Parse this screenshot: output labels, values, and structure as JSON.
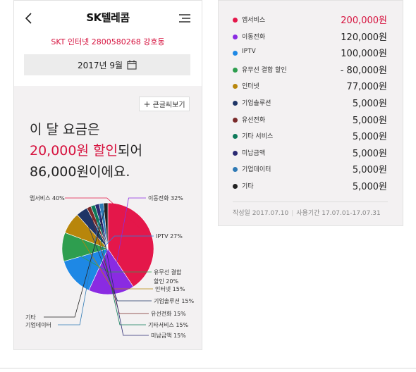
{
  "header": {
    "title": "SK텔레콤",
    "account": "SKT 인터넷 2800580268 강호동",
    "month": "2017년 9월"
  },
  "bigfont_label": "큰글씨보기",
  "headline": {
    "line1": "이 달 요금은",
    "discount": "20,000원 할인",
    "discount_suffix": "되어",
    "line3": "86,000원이에요."
  },
  "chart_data": {
    "type": "pie",
    "slices": [
      {
        "name": "앱서비스",
        "label": "앱서비스 40%",
        "value": 40,
        "color": "#e4174a"
      },
      {
        "name": "이동전화",
        "label": "이동전화 32%",
        "value": 16,
        "color": "#8a2be2"
      },
      {
        "name": "IPTV",
        "label": "IPTV 27%",
        "value": 13.5,
        "color": "#1e88e5"
      },
      {
        "name": "유무선 결합 할인",
        "label": "유무선 결합 할인 20%",
        "value": 10,
        "color": "#2e9e4f"
      },
      {
        "name": "인터넷",
        "label": "인터넷 15%",
        "value": 7.5,
        "color": "#b8860b"
      },
      {
        "name": "기업솔루션",
        "label": "기업솔루션 15%",
        "value": 4,
        "color": "#1f3566"
      },
      {
        "name": "유선전화",
        "label": "유선전화 15%",
        "value": 1.5,
        "color": "#7a2a2a"
      },
      {
        "name": "기타서비스",
        "label": "기타서비스 15%",
        "value": 1.5,
        "color": "#0e7a5a"
      },
      {
        "name": "미납금액",
        "label": "미납금액 15%",
        "value": 1.5,
        "color": "#2a2a72"
      },
      {
        "name": "기업데이터",
        "label": "기업데이터",
        "value": 1.5,
        "color": "#2f7ab5"
      },
      {
        "name": "기타",
        "label": "기타",
        "value": 1.5,
        "color": "#222222"
      }
    ]
  },
  "legend": {
    "items": [
      {
        "name": "앱서비스",
        "value": "200,000원",
        "color": "#e4174a",
        "accent": true
      },
      {
        "name": "이동전화",
        "value": "120,000원",
        "color": "#8a2be2"
      },
      {
        "name": "IPTV",
        "value": "100,000원",
        "color": "#1e88e5"
      },
      {
        "name": "유무선 결합 할인",
        "value": "- 80,000원",
        "color": "#2e9e4f"
      },
      {
        "name": "인터넷",
        "value": "77,000원",
        "color": "#b8860b"
      },
      {
        "name": "기업솔루션",
        "value": "5,000원",
        "color": "#1f3566"
      },
      {
        "name": "유선전화",
        "value": "5,000원",
        "color": "#7a2a2a"
      },
      {
        "name": "기타 서비스",
        "value": "5,000원",
        "color": "#0e7a5a"
      },
      {
        "name": "미납금액",
        "value": "5,000원",
        "color": "#2a2a72"
      },
      {
        "name": "기업데이터",
        "value": "5,000원",
        "color": "#2f7ab5"
      },
      {
        "name": "기타",
        "value": "5,000원",
        "color": "#222222"
      }
    ],
    "created": "작성일 2017.07.10",
    "period": "사용기간 17.07.01-17.07.31"
  }
}
